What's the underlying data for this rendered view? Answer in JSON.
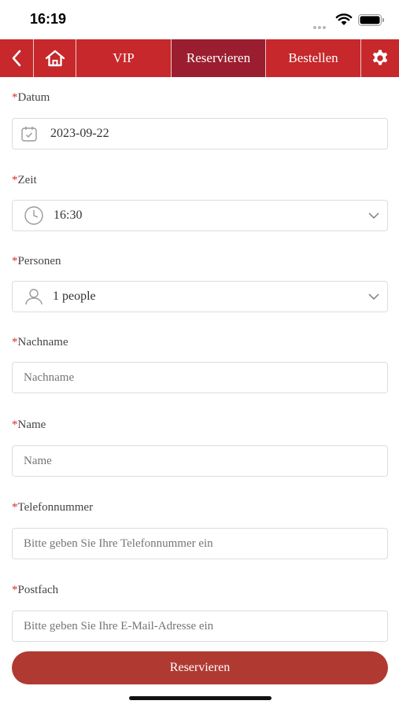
{
  "status_bar": {
    "time": "16:19"
  },
  "nav": {
    "back_icon": "chevron-left-icon",
    "home_icon": "home-icon",
    "vip": "VIP",
    "reserve": "Reservieren",
    "order": "Bestellen",
    "settings_icon": "gear-icon",
    "active_tab": "Reservieren"
  },
  "form": {
    "required_mark": "*",
    "date": {
      "label": "Datum",
      "value": "2023-09-22",
      "icon": "calendar-icon"
    },
    "time": {
      "label": "Zeit",
      "value": "16:30",
      "icon": "clock-icon"
    },
    "persons": {
      "label": "Personen",
      "value": "1 people",
      "icon": "user-icon"
    },
    "lastname": {
      "label": "Nachname",
      "placeholder": "Nachname"
    },
    "name": {
      "label": "Name",
      "placeholder": "Name"
    },
    "phone": {
      "label": "Telefonnummer",
      "placeholder": "Bitte geben Sie Ihre Telefonnummer ein"
    },
    "mailbox": {
      "label": "Postfach",
      "placeholder": "Bitte geben Sie Ihre E-Mail-Adresse ein"
    },
    "submit": "Reservieren"
  },
  "colors": {
    "brand_red": "#c6282b",
    "active_tab": "#9b1e30",
    "button": "#b03a32",
    "required": "#d0312d"
  }
}
